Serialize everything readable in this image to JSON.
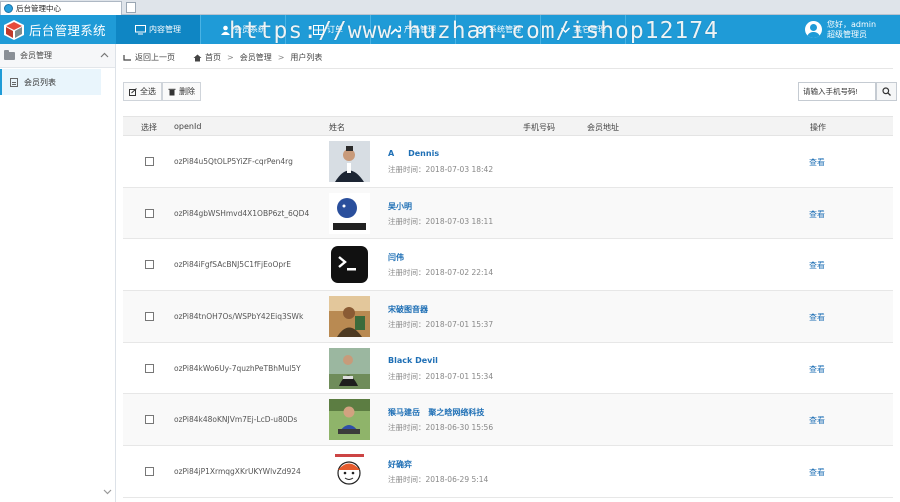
{
  "browser": {
    "tab_title": "后台管理中心"
  },
  "header": {
    "logo_text": "后台管理系统",
    "nav": [
      {
        "label": "内容管理",
        "icon": "monitor-icon"
      },
      {
        "label": "会员系统",
        "icon": "user-icon"
      },
      {
        "label": "订单",
        "icon": "grid-icon"
      },
      {
        "label": "产品管理",
        "icon": "wrench-icon"
      },
      {
        "label": "系统管理",
        "icon": "settings-icon"
      },
      {
        "label": "其它管理",
        "icon": "chevron-down-icon"
      }
    ],
    "watermark": "https://www.huzhan.com/ishop12174",
    "user_greeting": "您好，admin",
    "user_role": "超级管理员"
  },
  "sidebar": {
    "group_label": "会员管理",
    "items": [
      {
        "label": "会员列表"
      }
    ]
  },
  "breadcrumb": {
    "back": "返回上一页",
    "home": "首页",
    "section": "会员管理",
    "current": "用户列表"
  },
  "toolbar": {
    "select_all": "全选",
    "delete": "删除",
    "search_placeholder": "请输入手机号码!"
  },
  "table": {
    "headers": {
      "select": "选择",
      "openid": "openId",
      "name": "姓名",
      "phone": "手机号码",
      "address": "会员地址",
      "action": "操作"
    },
    "reg_prefix": "注册时间：",
    "rows": [
      {
        "openid": "ozPi84u5QtOLP5YiZF-cqrPen4rg",
        "name": "A     Dennis",
        "reg_time": "2018-07-03 18:42",
        "action": "查看",
        "avatar": "person-suit"
      },
      {
        "openid": "ozPi84gbWSHmvd4X1OBP6zt_6QD4",
        "name": "吴小明",
        "reg_time": "2018-07-03 18:11",
        "action": "查看",
        "avatar": "xiaoming-logo"
      },
      {
        "openid": "ozPi84iFgfSAcBNJ5C1fFjEoOprE",
        "name": "闫伟",
        "reg_time": "2018-07-02 22:14",
        "action": "查看",
        "avatar": "terminal"
      },
      {
        "openid": "ozPi84tnOH7Os/WSPbY42Eiq3SWk",
        "name": "宋破图音器",
        "reg_time": "2018-07-01 15:37",
        "action": "查看",
        "avatar": "photo-warm"
      },
      {
        "openid": "ozPi84kWo6Uy-7quzhPeTBhMul5Y",
        "name": "Black Devil",
        "reg_time": "2018-07-01 15:34",
        "action": "查看",
        "avatar": "person-outdoor"
      },
      {
        "openid": "ozPi84k48oKNJVm7Ej-LcD-u80Ds",
        "name": "猴马建岳   聚之晗网络科技",
        "reg_time": "2018-06-30 15:56",
        "action": "查看",
        "avatar": "person-grass"
      },
      {
        "openid": "ozPi84jP1XrmqgXKrUKYWlvZd924",
        "name": "好确弈",
        "reg_time": "2018-06-29 5:14",
        "action": "查看",
        "avatar": "cartoon"
      }
    ]
  },
  "colors": {
    "header_bg": "#1f9bd7",
    "link": "#1e6fb5"
  }
}
